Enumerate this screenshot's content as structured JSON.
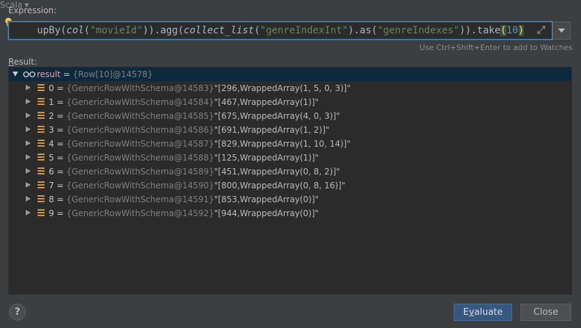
{
  "dialog": {
    "expression_label": "Expression:",
    "language": "Scala",
    "expression_tokens": [
      {
        "t": "upBy",
        "c": "t-plain"
      },
      {
        "t": "(",
        "c": "t-par"
      },
      {
        "t": "col",
        "c": "t-ital"
      },
      {
        "t": "(",
        "c": "t-par"
      },
      {
        "t": "\"movieId\"",
        "c": "t-str"
      },
      {
        "t": ")).agg(",
        "c": "t-plain"
      },
      {
        "t": "collect_list",
        "c": "t-ital"
      },
      {
        "t": "(",
        "c": "t-par"
      },
      {
        "t": "\"genreIndexInt\"",
        "c": "t-str"
      },
      {
        "t": ").as(",
        "c": "t-plain"
      },
      {
        "t": "\"genreIndexes\"",
        "c": "t-str"
      },
      {
        "t": ")).take",
        "c": "t-plain"
      },
      {
        "t": "(",
        "c": "t-hl"
      },
      {
        "t": "10",
        "c": "t-num"
      },
      {
        "t": ")",
        "c": "t-hl"
      }
    ],
    "hint": "Use Ctrl+Shift+Enter to add to Watches",
    "result_label_first": "R",
    "result_label_rest": "esult:",
    "help_label": "?",
    "evaluate_first": "E",
    "evaluate_u": "v",
    "evaluate_rest": "aluate",
    "close_label": "Close"
  },
  "result": {
    "root": {
      "name": "result",
      "eq": " = ",
      "type": "{Row[10]@14578}"
    },
    "items": [
      {
        "name": "0",
        "type": "{GenericRowWithSchema@14583}",
        "value": "\"[296,WrappedArray(1, 5, 0, 3)]\""
      },
      {
        "name": "1",
        "type": "{GenericRowWithSchema@14584}",
        "value": "\"[467,WrappedArray(1)]\""
      },
      {
        "name": "2",
        "type": "{GenericRowWithSchema@14585}",
        "value": "\"[675,WrappedArray(4, 0, 3)]\""
      },
      {
        "name": "3",
        "type": "{GenericRowWithSchema@14586}",
        "value": "\"[691,WrappedArray(1, 2)]\""
      },
      {
        "name": "4",
        "type": "{GenericRowWithSchema@14587}",
        "value": "\"[829,WrappedArray(1, 10, 14)]\""
      },
      {
        "name": "5",
        "type": "{GenericRowWithSchema@14588}",
        "value": "\"[125,WrappedArray(1)]\""
      },
      {
        "name": "6",
        "type": "{GenericRowWithSchema@14589}",
        "value": "\"[451,WrappedArray(0, 8, 2)]\""
      },
      {
        "name": "7",
        "type": "{GenericRowWithSchema@14590}",
        "value": "\"[800,WrappedArray(0, 8, 16)]\""
      },
      {
        "name": "8",
        "type": "{GenericRowWithSchema@14591}",
        "value": "\"[853,WrappedArray(0)]\""
      },
      {
        "name": "9",
        "type": "{GenericRowWithSchema@14592}",
        "value": "\"[944,WrappedArray(0)]\""
      }
    ]
  },
  "colors": {
    "accent": "#365880",
    "focus_border": "#4a88c7",
    "selection": "#0d293e",
    "field_icon": "#d69a3a"
  }
}
